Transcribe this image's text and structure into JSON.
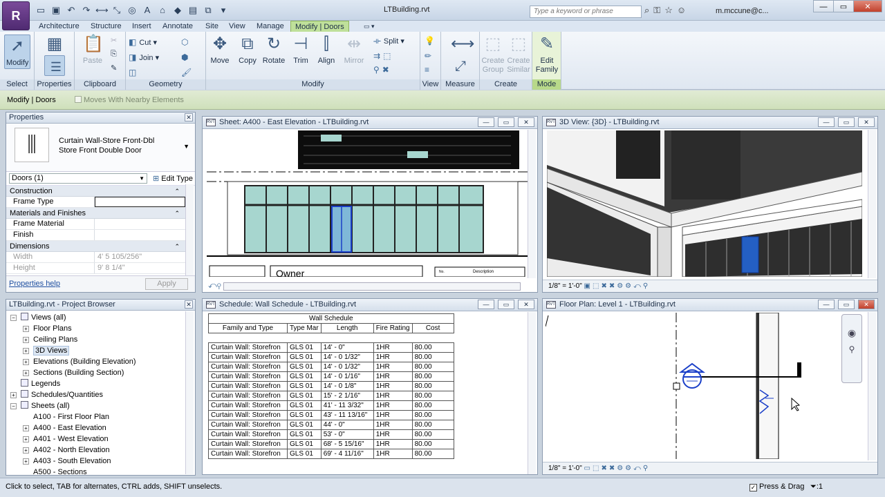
{
  "window": {
    "doc_title": "LTBuilding.rvt",
    "search_placeholder": "Type a keyword or phrase",
    "user": "m.mccune@c...",
    "app_letter": "R"
  },
  "tabs": [
    "Architecture",
    "Structure",
    "Insert",
    "Annotate",
    "Site",
    "View",
    "Manage",
    "Modify | Doors"
  ],
  "ribbon": {
    "select": {
      "label": "Select",
      "modify": "Modify"
    },
    "properties": {
      "label": "Properties"
    },
    "clipboard": {
      "label": "Clipboard",
      "paste": "Paste"
    },
    "geometry": {
      "label": "Geometry",
      "cut": "Cut",
      "join": "Join"
    },
    "modify": {
      "label": "Modify",
      "move": "Move",
      "copy": "Copy",
      "rotate": "Rotate",
      "trim": "Trim",
      "align": "Align",
      "mirror": "Mirror",
      "split": "Split"
    },
    "view": {
      "label": "View"
    },
    "measure": {
      "label": "Measure"
    },
    "create": {
      "label": "Create",
      "create_group": "Create Group",
      "create_similar": "Create Similar"
    },
    "mode": {
      "label": "Mode",
      "edit_family": "Edit Family"
    }
  },
  "context_bar": {
    "label": "Modify | Doors",
    "moves_with": "Moves With Nearby Elements"
  },
  "properties": {
    "title": "Properties",
    "type_line1": "Curtain Wall-Store Front-Dbl",
    "type_line2": "Store Front Double Door",
    "instance": "Doors (1)",
    "edit_type": "Edit Type",
    "sections": [
      {
        "name": "Construction",
        "rows": [
          {
            "n": "Frame Type",
            "v": ""
          }
        ]
      },
      {
        "name": "Materials and Finishes",
        "rows": [
          {
            "n": "Frame Material",
            "v": ""
          },
          {
            "n": "Finish",
            "v": ""
          }
        ]
      },
      {
        "name": "Dimensions",
        "rows": [
          {
            "n": "Width",
            "v": "4'  5 105/256\""
          },
          {
            "n": "Height",
            "v": "9'  8 1/4\""
          }
        ]
      }
    ],
    "help": "Properties help",
    "apply": "Apply"
  },
  "browser": {
    "title": "LTBuilding.rvt - Project Browser",
    "items": [
      {
        "label": "Views (all)",
        "indent": 0,
        "exp": "−"
      },
      {
        "label": "Floor Plans",
        "indent": 1,
        "exp": "+"
      },
      {
        "label": "Ceiling Plans",
        "indent": 1,
        "exp": "+"
      },
      {
        "label": "3D Views",
        "indent": 1,
        "exp": "+",
        "sel": true
      },
      {
        "label": "Elevations (Building Elevation)",
        "indent": 1,
        "exp": "+"
      },
      {
        "label": "Sections (Building Section)",
        "indent": 1,
        "exp": "+"
      },
      {
        "label": "Legends",
        "indent": 0,
        "exp": ""
      },
      {
        "label": "Schedules/Quantities",
        "indent": 0,
        "exp": "+"
      },
      {
        "label": "Sheets (all)",
        "indent": 0,
        "exp": "−"
      },
      {
        "label": "A100 - First Floor Plan",
        "indent": 1,
        "exp": ""
      },
      {
        "label": "A400 - East Elevation",
        "indent": 1,
        "exp": "+"
      },
      {
        "label": "A401 - West Elevation",
        "indent": 1,
        "exp": "+"
      },
      {
        "label": "A402 - North Elevation",
        "indent": 1,
        "exp": "+"
      },
      {
        "label": "A403 - South Elevation",
        "indent": 1,
        "exp": "+"
      },
      {
        "label": "A500 - Sections",
        "indent": 1,
        "exp": ""
      }
    ]
  },
  "views": {
    "sheet": {
      "title": "Sheet: A400 - East Elevation - LTBuilding.rvt",
      "owner": "Owner",
      "desc": "Description",
      "no": "No."
    },
    "view3d": {
      "title": "3D View: {3D} - LTBuilding.rvt",
      "scale": "1/8\" = 1'-0\""
    },
    "schedule": {
      "title": "Schedule: Wall Schedule - LTBuilding.rvt"
    },
    "plan": {
      "title": "Floor Plan: Level 1 - LTBuilding.rvt",
      "scale": "1/8\" = 1'-0\""
    }
  },
  "schedule": {
    "title": "Wall Schedule",
    "headers": [
      "Family and Type",
      "Type Mar",
      "Length",
      "Fire Rating",
      "Cost"
    ],
    "rows": [
      [
        "Curtain Wall: Storefron",
        "GLS 01",
        "14' - 0\"",
        "1HR",
        "80.00"
      ],
      [
        "Curtain Wall: Storefron",
        "GLS 01",
        "14' - 0 1/32\"",
        "1HR",
        "80.00"
      ],
      [
        "Curtain Wall: Storefron",
        "GLS 01",
        "14' - 0 1/32\"",
        "1HR",
        "80.00"
      ],
      [
        "Curtain Wall: Storefron",
        "GLS 01",
        "14' - 0 1/16\"",
        "1HR",
        "80.00"
      ],
      [
        "Curtain Wall: Storefron",
        "GLS 01",
        "14' - 0 1/8\"",
        "1HR",
        "80.00"
      ],
      [
        "Curtain Wall: Storefron",
        "GLS 01",
        "15' - 2 1/16\"",
        "1HR",
        "80.00"
      ],
      [
        "Curtain Wall: Storefron",
        "GLS 01",
        "41' - 11 3/32\"",
        "1HR",
        "80.00"
      ],
      [
        "Curtain Wall: Storefron",
        "GLS 01",
        "43' - 11 13/16\"",
        "1HR",
        "80.00"
      ],
      [
        "Curtain Wall: Storefron",
        "GLS 01",
        "44' - 0\"",
        "1HR",
        "80.00"
      ],
      [
        "Curtain Wall: Storefron",
        "GLS 01",
        "53' - 0\"",
        "1HR",
        "80.00"
      ],
      [
        "Curtain Wall: Storefron",
        "GLS 01",
        "68' - 5 15/16\"",
        "1HR",
        "80.00"
      ],
      [
        "Curtain Wall: Storefron",
        "GLS 01",
        "69' - 4 11/16\"",
        "1HR",
        "80.00"
      ]
    ]
  },
  "status": {
    "hint": "Click to select, TAB for alternates, CTRL adds, SHIFT unselects.",
    "press_drag": "Press & Drag",
    "filter": ":1"
  }
}
